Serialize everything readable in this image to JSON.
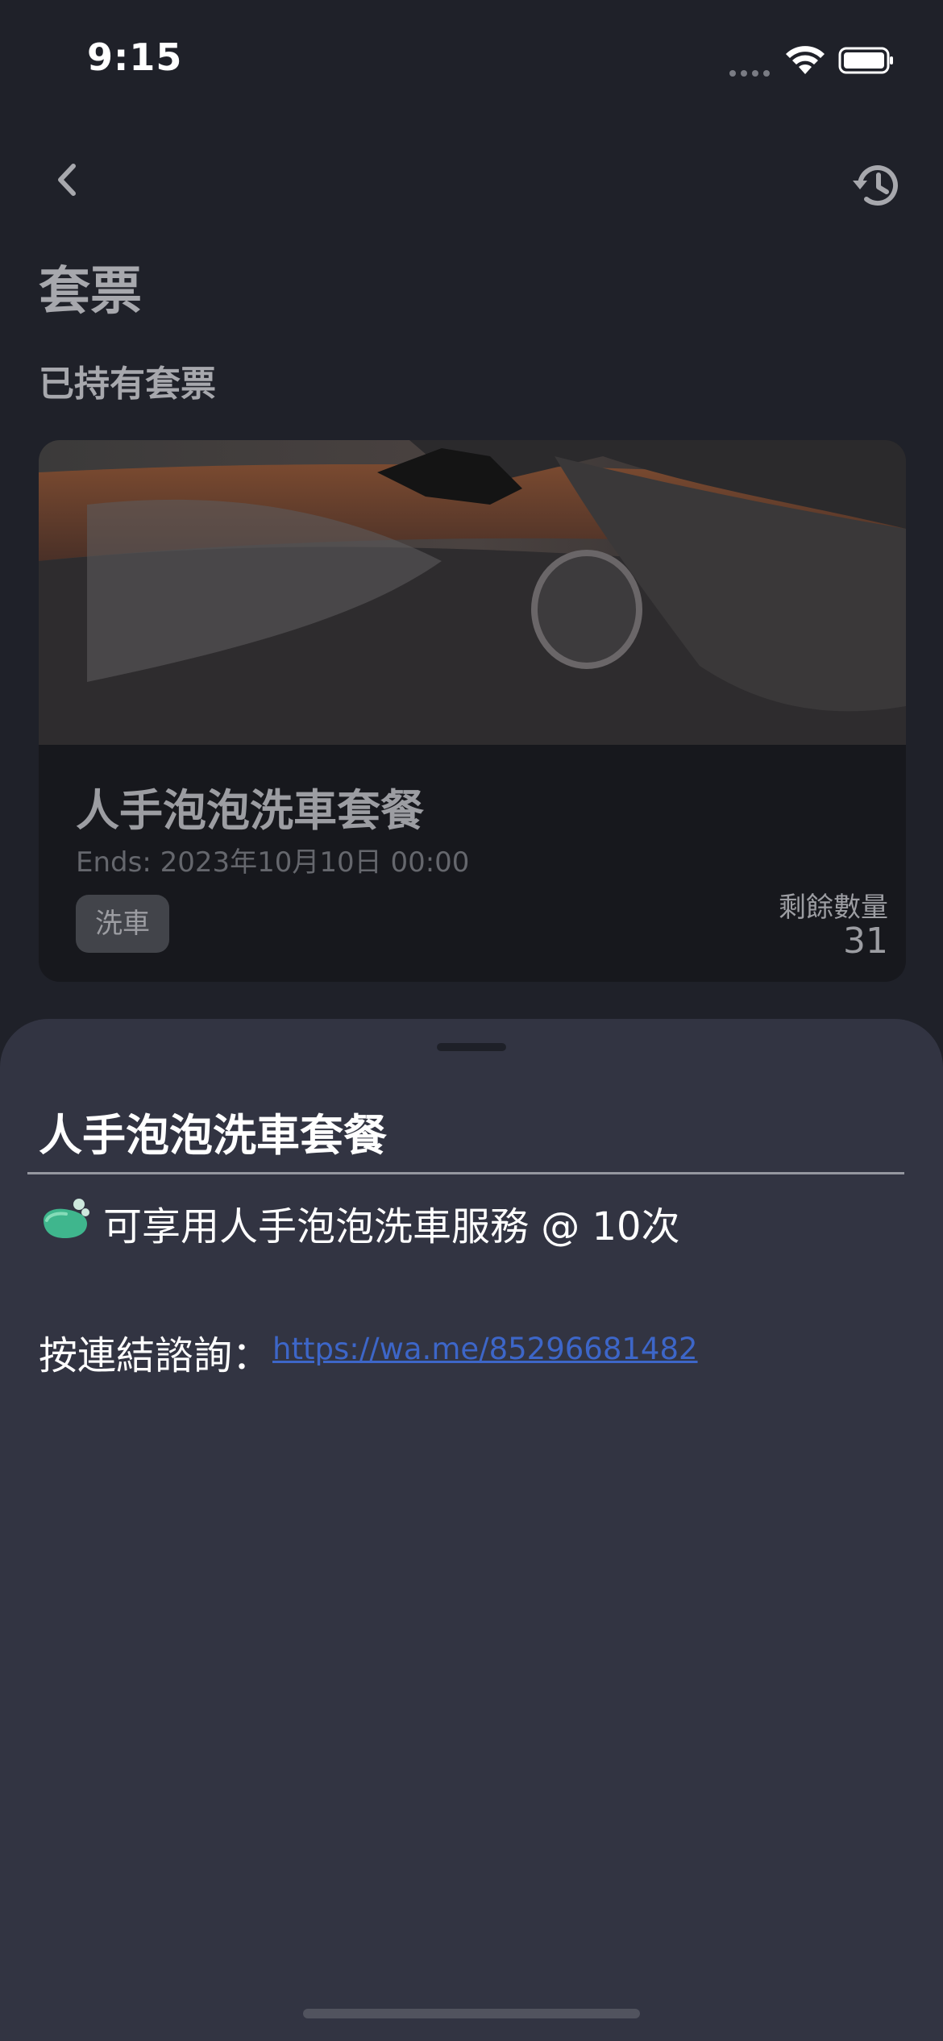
{
  "status_bar": {
    "time": "9:15"
  },
  "header": {
    "title": "套票",
    "section_label": "已持有套票"
  },
  "ticket": {
    "name": "人手泡泡洗車套餐",
    "ends": "Ends: 2023年10月10日 00:00",
    "tag": "洗車",
    "remaining_label": "剩餘數量",
    "remaining_value": "31"
  },
  "sheet": {
    "title": "人手泡泡洗車套餐",
    "benefit_text": "可享用人手泡泡洗車服務 @ 10次",
    "contact_label": "按連結諮詢：",
    "contact_link": "https://wa.me/85296681482"
  },
  "icons": {
    "back": "chevron-left-icon",
    "history": "history-clock-icon",
    "benefit": "car-wash-sponge-icon",
    "wifi": "wifi-icon",
    "battery": "battery-icon"
  }
}
